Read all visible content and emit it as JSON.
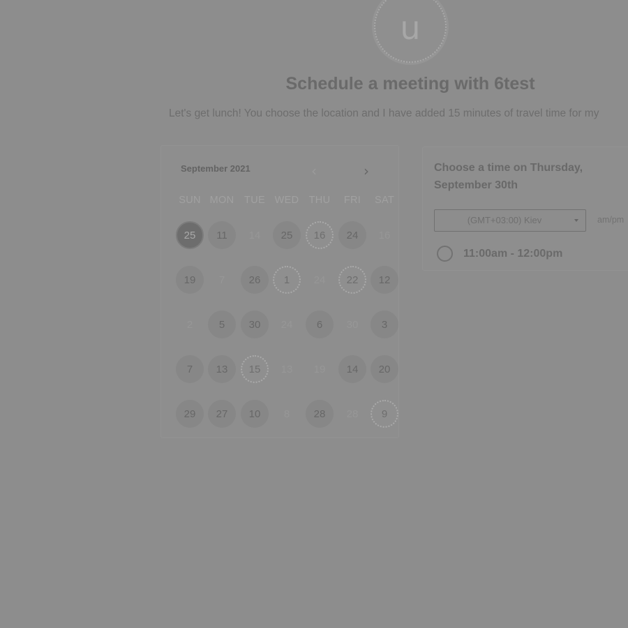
{
  "profile": {
    "avatar_letter": "u"
  },
  "header": {
    "title": "Schedule a meeting with 6test",
    "subtitle": "Let's get lunch! You choose the location and I have added 15 minutes of travel time for my"
  },
  "calendar": {
    "month": "September 2021",
    "prev_icon": "‹",
    "next_icon": "›",
    "weekdays": [
      "SUN",
      "MON",
      "TUE",
      "WED",
      "THU",
      "FRI",
      "SAT"
    ],
    "weeks": [
      [
        {
          "label": "25",
          "state": "selected"
        },
        {
          "label": "11",
          "state": "available"
        },
        {
          "label": "14",
          "state": "unavailable"
        },
        {
          "label": "25",
          "state": "available"
        },
        {
          "label": "16",
          "state": "dotted"
        },
        {
          "label": "24",
          "state": "available"
        },
        {
          "label": "16",
          "state": "unavailable"
        }
      ],
      [
        {
          "label": "19",
          "state": "available"
        },
        {
          "label": "7",
          "state": "unavailable"
        },
        {
          "label": "26",
          "state": "available"
        },
        {
          "label": "1",
          "state": "dotted"
        },
        {
          "label": "24",
          "state": "unavailable"
        },
        {
          "label": "22",
          "state": "dotted"
        },
        {
          "label": "12",
          "state": "available"
        }
      ],
      [
        {
          "label": "2",
          "state": "unavailable"
        },
        {
          "label": "5",
          "state": "available"
        },
        {
          "label": "30",
          "state": "available"
        },
        {
          "label": "24",
          "state": "unavailable"
        },
        {
          "label": "6",
          "state": "available"
        },
        {
          "label": "30",
          "state": "unavailable"
        },
        {
          "label": "3",
          "state": "available"
        }
      ],
      [
        {
          "label": "7",
          "state": "available"
        },
        {
          "label": "13",
          "state": "available"
        },
        {
          "label": "15",
          "state": "dotted"
        },
        {
          "label": "13",
          "state": "unavailable"
        },
        {
          "label": "19",
          "state": "unavailable"
        },
        {
          "label": "14",
          "state": "available"
        },
        {
          "label": "20",
          "state": "available"
        }
      ],
      [
        {
          "label": "29",
          "state": "available"
        },
        {
          "label": "27",
          "state": "available"
        },
        {
          "label": "10",
          "state": "available"
        },
        {
          "label": "8",
          "state": "unavailable"
        },
        {
          "label": "28",
          "state": "available"
        },
        {
          "label": "28",
          "state": "unavailable"
        },
        {
          "label": "9",
          "state": "dotted"
        }
      ]
    ]
  },
  "time_panel": {
    "heading": "Choose a time on Thursday, September 30th",
    "timezone": "(GMT+03:00) Kiev",
    "format_toggle": "am/pm",
    "slots": [
      "11:00am - 12:00pm"
    ]
  }
}
